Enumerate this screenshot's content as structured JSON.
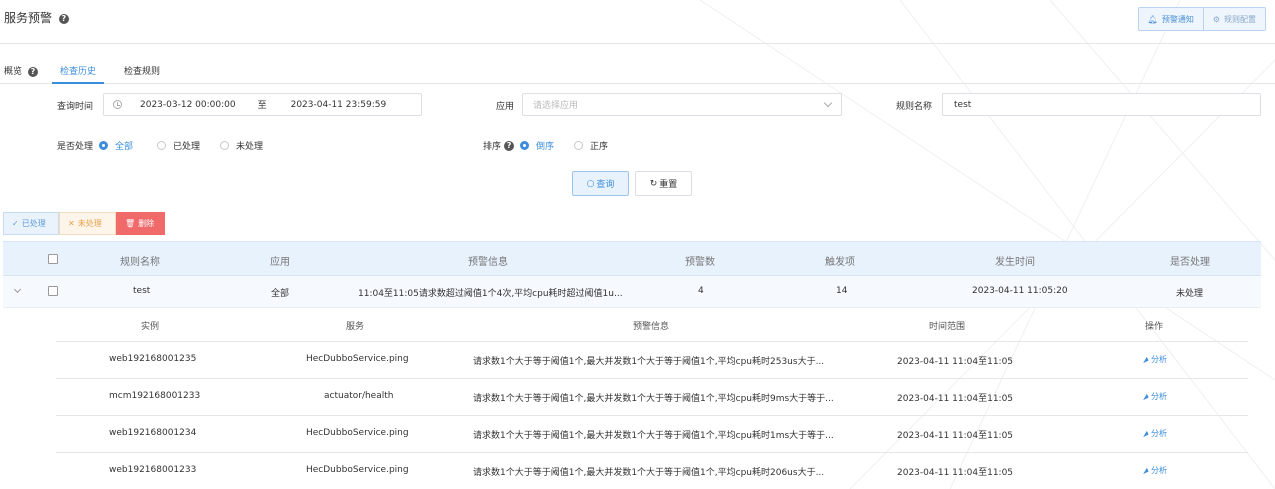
{
  "page": {
    "title": "服务预警",
    "help_icon": "question-circle-icon",
    "actions": [
      {
        "label": "预警通知",
        "icon": "bell-icon"
      },
      {
        "label": "规则配置",
        "icon": "gear-icon"
      }
    ]
  },
  "tabs": {
    "overview": "概览",
    "history": "检查历史",
    "rules": "检查规则",
    "active": "检查历史"
  },
  "filters": {
    "time_label": "查询时间",
    "start": "2023-03-12 00:00:00",
    "range_sep": "至",
    "end": "2023-04-11 23:59:59",
    "app_label": "应用",
    "app_placeholder": "请选择应用",
    "rule_label": "规则名称",
    "rule_value": "test",
    "handled_label": "是否处理",
    "handled_options": [
      "全部",
      "已处理",
      "未处理"
    ],
    "handled_selected": "全部",
    "sort_label": "排序",
    "sort_options": [
      "倒序",
      "正序"
    ],
    "sort_selected": "倒序",
    "search_button": "查询",
    "reset_button": "重置"
  },
  "batch_actions": {
    "handled": "已处理",
    "unhandled": "未处理",
    "delete": "删除"
  },
  "table": {
    "columns": [
      "规则名称",
      "应用",
      "预警信息",
      "预警数",
      "触发项",
      "发生时间",
      "是否处理"
    ],
    "rows": [
      {
        "rule": "test",
        "app": "全部",
        "info": "11:04至11:05请求数超过阈值1个4次,平均cpu耗时超过阈值1u...",
        "count": "4",
        "triggers": "14",
        "time": "2023-04-11 11:05:20",
        "status": "未处理"
      }
    ]
  },
  "sub_table": {
    "columns": [
      "实例",
      "服务",
      "预警信息",
      "时间范围",
      "操作"
    ],
    "action_label": "分析",
    "rows": [
      {
        "instance": "web192168001235",
        "service": "HecDubboService.ping",
        "info": "请求数1个大于等于阈值1个,最大并发数1个大于等于阈值1个,平均cpu耗时253us大于...",
        "range": "2023-04-11 11:04至11:05"
      },
      {
        "instance": "mcm192168001233",
        "service": "actuator/health",
        "info": "请求数1个大于等于阈值1个,最大并发数1个大于等于阈值1个,平均cpu耗时9ms大于等于...",
        "range": "2023-04-11 11:04至11:05"
      },
      {
        "instance": "web192168001234",
        "service": "HecDubboService.ping",
        "info": "请求数1个大于等于阈值1个,最大并发数1个大于等于阈值1个,平均cpu耗时1ms大于等于...",
        "range": "2023-04-11 11:04至11:05"
      },
      {
        "instance": "web192168001233",
        "service": "HecDubboService.ping",
        "info": "请求数1个大于等于阈值1个,最大并发数1个大于等于阈值1个,平均cpu耗时206us大于...",
        "range": "2023-04-11 11:04至11:05"
      }
    ]
  },
  "colors": {
    "accent": "#3c8ddb",
    "danger": "#f06a6a",
    "warning": "#e6a04a"
  }
}
